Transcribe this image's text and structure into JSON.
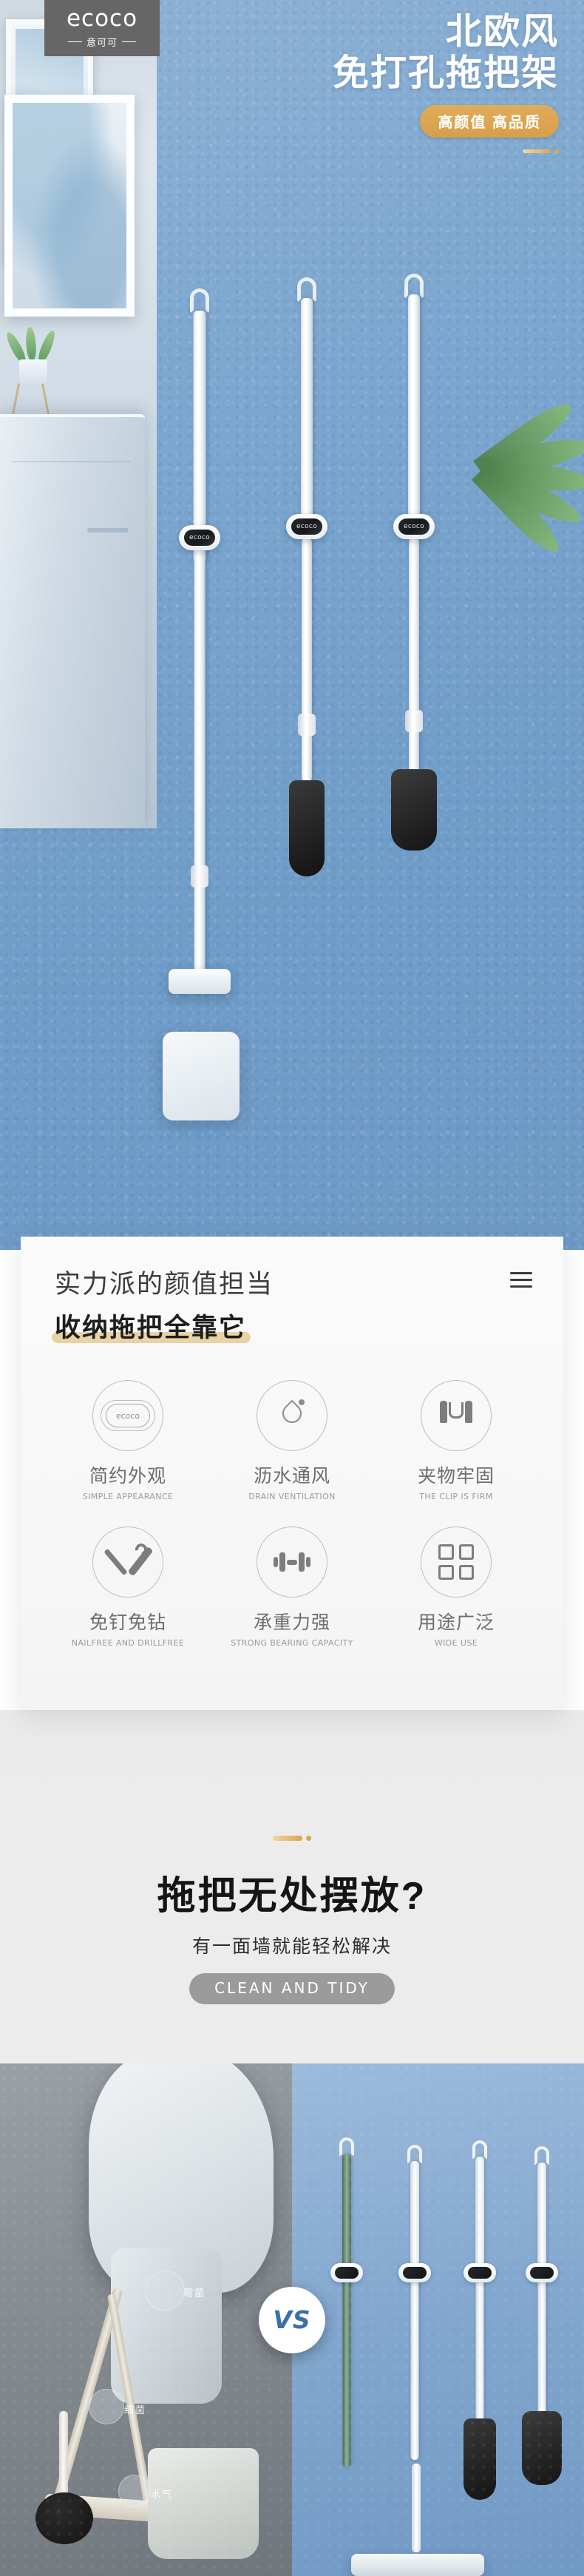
{
  "brand": {
    "logo_word": "ecoco",
    "logo_sub": "意可可"
  },
  "hero": {
    "headline_line1": "北欧风",
    "headline_line2": "免打孔拖把架",
    "badge": "高颜值 高品质",
    "product_chip_label": "ecoco"
  },
  "card": {
    "title_line1": "实力派的颜值担当",
    "title_line2": "收纳拖把全靠它",
    "menu_icon": "hamburger-icon",
    "features": [
      {
        "icon": "ecoco-chip-icon",
        "label": "简约外观",
        "en": "SIMPLE APPEARANCE"
      },
      {
        "icon": "water-drop-icon",
        "label": "沥水通风",
        "en": "DRAIN VENTILATION"
      },
      {
        "icon": "clip-grip-icon",
        "label": "夹物牢固",
        "en": "THE CLIP IS FIRM"
      },
      {
        "icon": "tools-icon",
        "label": "免钉免钻",
        "en": "NAILFREE AND DRILLFREE"
      },
      {
        "icon": "dumbbell-icon",
        "label": "承重力强",
        "en": "STRONG BEARING CAPACITY"
      },
      {
        "icon": "four-squares-icon",
        "label": "用途广泛",
        "en": "WIDE USE"
      }
    ]
  },
  "mid_section": {
    "heading": "拖把无处摆放?",
    "subheading": "有一面墙就能轻松解决",
    "pill": "CLEAN  AND  TIDY"
  },
  "comparison": {
    "vs_label": "VS",
    "left_labels": [
      "霉菌",
      "细菌",
      "水气"
    ]
  },
  "colors": {
    "hero_blue": "#7ba6cf",
    "gold": "#d9a64d",
    "highlight_tan": "#e8d3a5",
    "logo_gray": "#666666",
    "pill_gray": "#9b9b9b",
    "vs_blue": "#3c6ea8"
  }
}
